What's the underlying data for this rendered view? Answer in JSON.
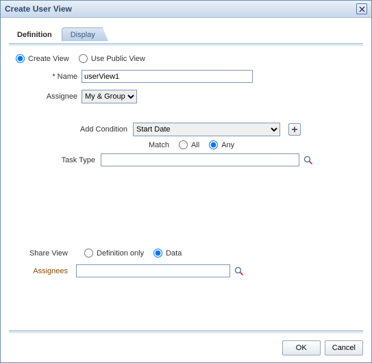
{
  "title": "Create User View",
  "tabs": {
    "definition": "Definition",
    "display": "Display"
  },
  "viewMode": {
    "create": "Create View",
    "usePublic": "Use Public View",
    "selected": "create"
  },
  "nameLabel": "Name",
  "nameValue": "userView1",
  "assigneeLabel": "Assignee",
  "assigneeOptions": [
    "My & Group"
  ],
  "assigneeSelected": "My & Group",
  "addConditionLabel": "Add Condition",
  "conditionOptions": [
    "Start Date"
  ],
  "conditionSelected": "Start Date",
  "match": {
    "label": "Match",
    "all": "All",
    "any": "Any",
    "selected": "any"
  },
  "taskTypeLabel": "Task Type",
  "taskTypeValue": "",
  "shareView": {
    "label": "Share View",
    "definitionOnly": "Definition only",
    "data": "Data",
    "selected": "data"
  },
  "assigneesLabel": "Assignees",
  "assigneesValue": "",
  "buttons": {
    "ok": "OK",
    "cancel": "Cancel"
  }
}
